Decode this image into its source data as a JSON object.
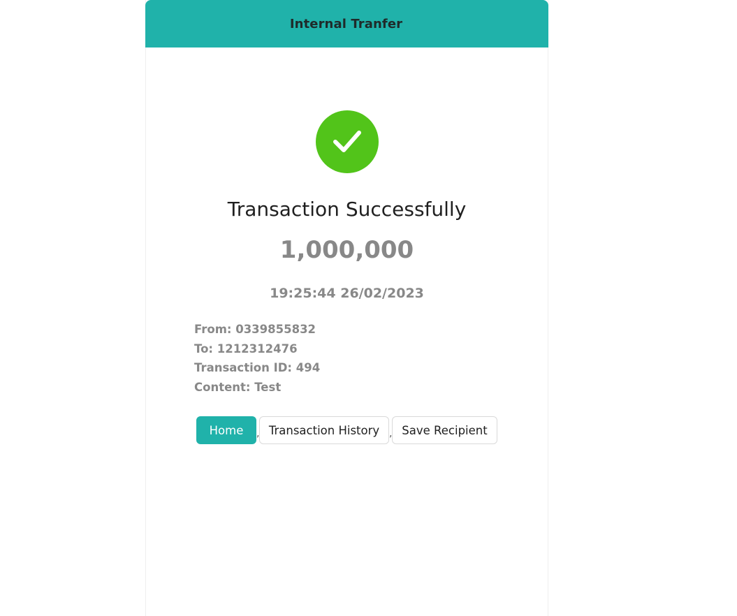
{
  "header": {
    "title": "Internal Tranfer"
  },
  "status": {
    "icon": "check-circle-icon",
    "icon_color": "#52c41a",
    "title": "Transaction Successfully"
  },
  "amount": "1,000,000",
  "datetime": "19:25:44 26/02/2023",
  "details": {
    "from": "From: 0339855832",
    "to": "To: 1212312476",
    "transaction_id": "Transaction ID: 494",
    "content": "Content: Test"
  },
  "actions": {
    "home_label": "Home",
    "separator": ",",
    "history_label": "Transaction History",
    "save_label": "Save Recipient"
  },
  "colors": {
    "accent": "#20b2aa",
    "success": "#52c41a",
    "muted_text": "#888888"
  }
}
